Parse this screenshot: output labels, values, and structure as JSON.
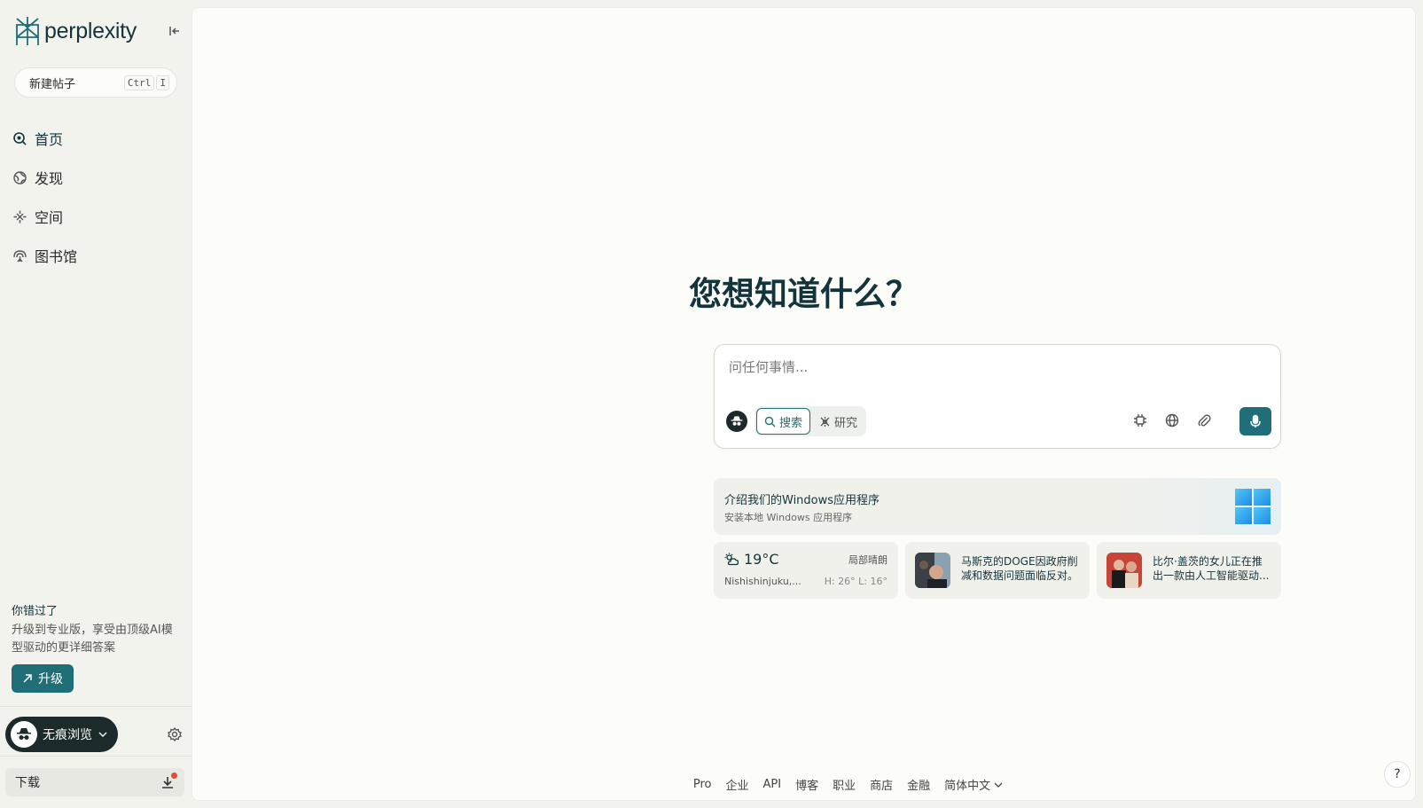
{
  "app": {
    "brand": "perplexity"
  },
  "sidebar": {
    "new_thread": {
      "label": "新建帖子",
      "shortcut_key1": "Ctrl",
      "shortcut_key2": "I"
    },
    "items": [
      {
        "label": "首页",
        "icon": "search-icon",
        "active": true
      },
      {
        "label": "发现",
        "icon": "globe-icon",
        "active": false
      },
      {
        "label": "空间",
        "icon": "spaces-icon",
        "active": false
      },
      {
        "label": "图书馆",
        "icon": "library-icon",
        "active": false
      }
    ],
    "promo": {
      "title": "你错过了",
      "text": "升级到专业版，享受由顶级AI模型驱动的更详细答案",
      "button": "升级"
    },
    "incognito_label": "无痕浏览",
    "download_label": "下载"
  },
  "main": {
    "headline": "您想知道什么？",
    "search": {
      "placeholder": "问任何事情...",
      "mode_search": "搜索",
      "mode_research": "研究"
    },
    "banner": {
      "title": "介绍我们的Windows应用程序",
      "subtitle": "安装本地 Windows 应用程序"
    },
    "weather": {
      "temp": "19°C",
      "desc": "局部晴朗",
      "location": "Nishishinjuku,...",
      "hilo": "H: 26° L: 16°"
    },
    "news": [
      {
        "text": "马斯克的DOGE因政府削减和数据问题面临反对。"
      },
      {
        "text": "比尔·盖茨的女儿正在推出一款由人工智能驱动..."
      }
    ]
  },
  "footer": {
    "links": [
      "Pro",
      "企业",
      "API",
      "博客",
      "职业",
      "商店",
      "金融"
    ],
    "language": "简体中文"
  },
  "colors": {
    "accent": "#1f6e78",
    "background": "#fcfcf9",
    "sidebar": "#f3f3ee"
  }
}
